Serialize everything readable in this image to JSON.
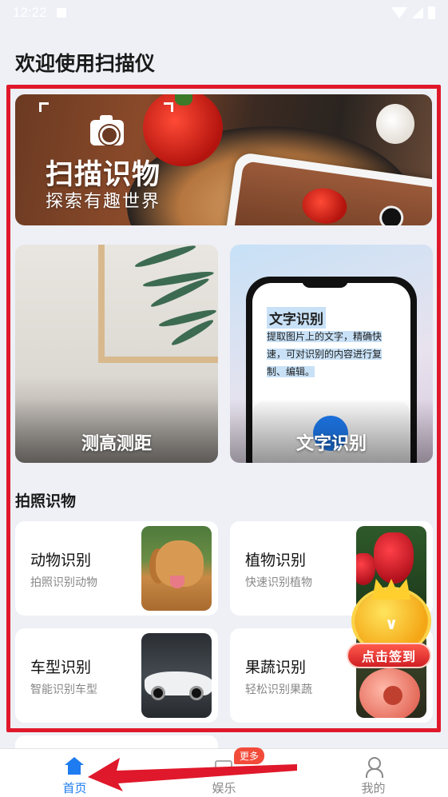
{
  "status_bar": {
    "time": "12:22"
  },
  "page": {
    "title": "欢迎使用扫描仪"
  },
  "banner": {
    "title": "扫描识物",
    "subtitle": "探索有趣世界"
  },
  "feature_cards": [
    {
      "label": "测高测距"
    },
    {
      "label": "文字识别",
      "mock_title": "文字识别",
      "mock_text": "提取图片上的文字，精确快速，可对识别的内容进行复制、编辑。"
    }
  ],
  "section": {
    "title": "拍照识物"
  },
  "items": [
    {
      "title": "动物识别",
      "subtitle": "拍照识别动物",
      "image": "golden-retriever-photo"
    },
    {
      "title": "植物识别",
      "subtitle": "快速识别植物",
      "image": "red-tulip-photo"
    },
    {
      "title": "车型识别",
      "subtitle": "智能识别车型",
      "image": "white-sports-car-photo"
    },
    {
      "title": "果蔬识别",
      "subtitle": "轻松识别果蔬",
      "image": "peach-photo"
    }
  ],
  "signin": {
    "label": "点击签到"
  },
  "tabs": [
    {
      "label": "首页",
      "icon": "home-icon",
      "active": true
    },
    {
      "label": "娱乐",
      "icon": "entertainment-icon",
      "badge": "更多"
    },
    {
      "label": "我的",
      "icon": "profile-icon"
    }
  ],
  "colors": {
    "accent": "#1e7bf0",
    "annotation_red": "#e0182b"
  }
}
